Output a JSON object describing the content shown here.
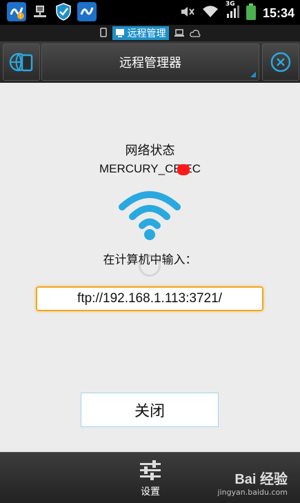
{
  "status_bar": {
    "time": "15:34",
    "network_type": "3G",
    "icons": [
      "app-update-icon",
      "network-computer-icon",
      "shield-icon",
      "app-update-icon-2",
      "mute-icon",
      "wifi-signal-icon",
      "cell-signal-icon",
      "battery-icon"
    ]
  },
  "tab_strip": {
    "active_tab": "远程管理"
  },
  "toolbar": {
    "title": "远程管理器",
    "left_icon": "globe-device-icon",
    "right_icon": "close-circle-icon"
  },
  "content": {
    "network_label": "网络状态",
    "ssid": "MERCURY_CE   EC",
    "prompt": "在计算机中输入：",
    "ftp_url": "ftp://192.168.1.113:3721/",
    "close_button": "关闭"
  },
  "bottom_bar": {
    "settings_label": "设置",
    "watermark_main": "Bai 经验",
    "watermark_sub": "jingyan.baidu.com"
  },
  "colors": {
    "accent_blue": "#1e90c8",
    "wifi_blue": "#2aa8e0",
    "input_border": "#f0a81e"
  }
}
